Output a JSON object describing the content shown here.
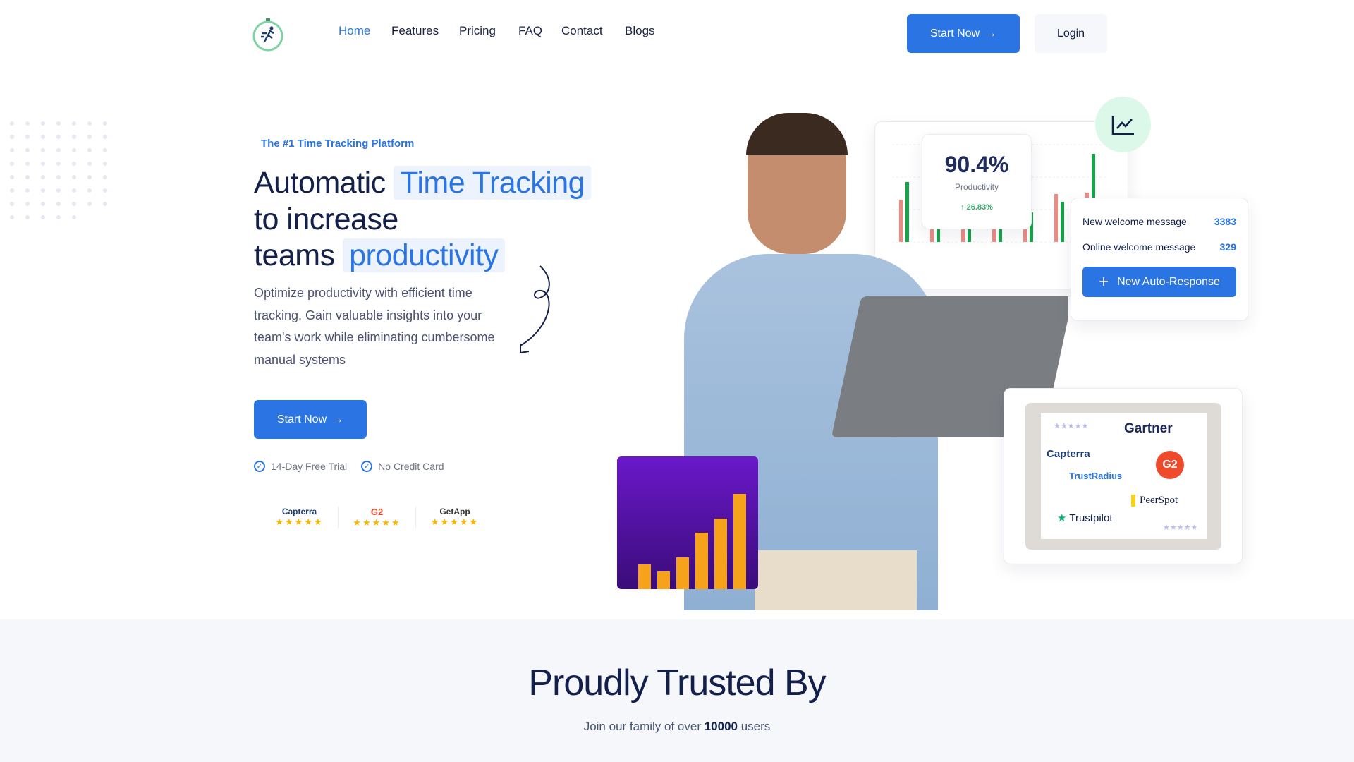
{
  "nav": {
    "items": [
      "Home",
      "Features",
      "Pricing",
      "FAQ",
      "Contact",
      "Blogs"
    ],
    "active": "Home",
    "start_label": "Start Now",
    "login_label": "Login"
  },
  "hero": {
    "tagline": "The #1 Time Tracking Platform",
    "line1": "Automatic",
    "line1_hl": "Time Tracking",
    "line2": "to increase",
    "line3": "teams",
    "line3_hl": "productivity",
    "description": "Optimize productivity with efficient time tracking. Gain valuable insights into your team's work while eliminating cumbersome manual systems",
    "cta_label": "Start Now",
    "checks": [
      "14-Day Free Trial",
      "No Credit Card"
    ],
    "ratings": [
      {
        "name": "Capterra",
        "stars": 5
      },
      {
        "name": "G2",
        "stars": 5
      },
      {
        "name": "GetApp",
        "stars": 5
      }
    ]
  },
  "stats": {
    "value": "90.4%",
    "label": "Productivity",
    "change": "26.83%"
  },
  "welcome": {
    "rows": [
      {
        "label": "New welcome message",
        "value": "3383"
      },
      {
        "label": "Online welcome message",
        "value": "329"
      }
    ],
    "button": "New Auto-Response"
  },
  "reviews": {
    "brands": [
      "Gartner",
      "Capterra",
      "TrustRadius",
      "G2",
      "PeerSpot",
      "Trustpilot"
    ]
  },
  "trusted": {
    "title": "Proudly Trusted By",
    "sub_pre": "Join our family of over ",
    "sub_count": "10000",
    "sub_post": " users"
  },
  "colors": {
    "accent": "#2a74e4",
    "dark": "#13204a",
    "green": "#16a34a",
    "red": "#ef8a80"
  }
}
